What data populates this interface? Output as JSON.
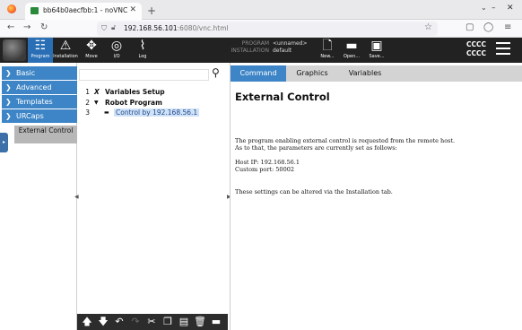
{
  "browser": {
    "tab_title": "bb64b0aecfbb:1 - noVNC",
    "url_host": "192.168.56.101",
    "url_rest": ":6080/vnc.html",
    "new_tab_icon": "plus-icon"
  },
  "header": {
    "tabs": [
      {
        "label": "Program",
        "icon": "program-icon",
        "active": true
      },
      {
        "label": "Installation",
        "icon": "installation-icon",
        "active": false
      },
      {
        "label": "Move",
        "icon": "move-icon",
        "active": false
      },
      {
        "label": "I/O",
        "icon": "io-icon",
        "active": false
      },
      {
        "label": "Log",
        "icon": "log-icon",
        "active": false
      }
    ],
    "program_label": "PROGRAM",
    "program_value": "<unnamed>",
    "installation_label": "INSTALLATION",
    "installation_value": "default",
    "file_buttons": [
      "New...",
      "Open...",
      "Save..."
    ],
    "status_line1": "CCCC",
    "status_line2": "CCCC"
  },
  "leftnav": {
    "items": [
      "Basic",
      "Advanced",
      "Templates",
      "URCaps"
    ],
    "sub_item": "External Control"
  },
  "tree": {
    "rows": [
      {
        "num": "1",
        "icon": "X",
        "label": "Variables Setup"
      },
      {
        "num": "2",
        "icon": "▼",
        "label": "Robot Program"
      },
      {
        "num": "3",
        "icon": "▬",
        "label": "Control by 192.168.56.1"
      }
    ]
  },
  "panel": {
    "tabs": [
      "Command",
      "Graphics",
      "Variables"
    ],
    "active_tab": "Command",
    "title": "External Control",
    "line1": "The program enabling external control is requested from the remote host.",
    "line2": "As to that, the parameters are currently set as follows:",
    "host_ip": "Host IP: 192.168.56.1",
    "custom_port": "Custom port: 50002",
    "line3": "These settings can be altered via the Installation tab."
  },
  "colors": {
    "accent": "#3d85c6",
    "header_bg": "#222222",
    "selected_sub": "#b7b7b7"
  }
}
